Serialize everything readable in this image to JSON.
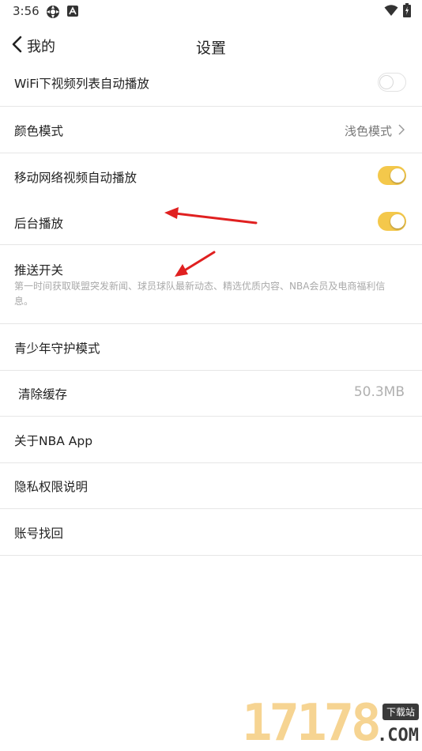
{
  "status_bar": {
    "time": "3:56",
    "app_icons": [
      "gear-icon",
      "a-badge-icon"
    ],
    "right_icons": [
      "wifi-icon",
      "battery-charging-icon"
    ]
  },
  "nav": {
    "back_label": "我的",
    "title": "设置"
  },
  "settings": {
    "wifi_autoplay": {
      "label": "WiFi下视频列表自动播放",
      "enabled": false
    },
    "color_mode": {
      "label": "颜色模式",
      "value": "浅色模式"
    },
    "mobile_autoplay": {
      "label": "移动网络视频自动播放",
      "enabled": true
    },
    "background_play": {
      "label": "后台播放",
      "enabled": true
    },
    "push": {
      "label": "推送开关",
      "description": "第一时间获取联盟突发新闻、球员球队最新动态、精选优质内容、NBA会员及电商福利信息。"
    },
    "youth_mode": {
      "label": "青少年守护模式"
    },
    "clear_cache": {
      "label": "清除缓存",
      "value": "50.3MB"
    },
    "about": {
      "label": "关于NBA App"
    },
    "privacy": {
      "label": "隐私权限说明"
    },
    "account_recovery": {
      "label": "账号找回"
    }
  },
  "colors": {
    "toggle_on": "#f4c84b",
    "annotation_arrow": "#e02020"
  },
  "watermark": {
    "digits": "17178",
    "badge": "下载站",
    "suffix": ".COM"
  }
}
